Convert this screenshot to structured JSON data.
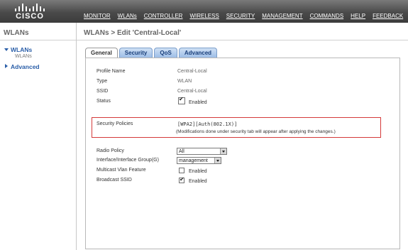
{
  "header": {
    "logo_text": "CISCO",
    "nav": [
      "MONITOR",
      "WLANs",
      "CONTROLLER",
      "WIRELESS",
      "SECURITY",
      "MANAGEMENT",
      "COMMANDS",
      "HELP",
      "FEEDBACK"
    ]
  },
  "sidebar": {
    "title": "WLANs",
    "items": [
      {
        "label": "WLANs",
        "sub": "WLANs",
        "expanded": true
      },
      {
        "label": "Advanced",
        "expanded": false
      }
    ]
  },
  "main": {
    "title": "WLANs > Edit  'Central-Local'",
    "tabs": [
      {
        "label": "General",
        "active": true
      },
      {
        "label": "Security",
        "active": false
      },
      {
        "label": "QoS",
        "active": false
      },
      {
        "label": "Advanced",
        "active": false
      }
    ],
    "fields": {
      "profile_name_label": "Profile Name",
      "profile_name_value": "Central-Local",
      "type_label": "Type",
      "type_value": "WLAN",
      "ssid_label": "SSID",
      "ssid_value": "Central-Local",
      "status_label": "Status",
      "status_checkbox_label": "Enabled",
      "status_checked": true,
      "security_label": "Security Policies",
      "security_value": "[WPA2][Auth(802.1X)]",
      "security_note": "(Modifications done under security tab will appear after applying the changes.)",
      "radio_policy_label": "Radio Policy",
      "radio_policy_value": "All",
      "interface_label": "Interface/Interface Group(G)",
      "interface_value": "management",
      "multicast_label": "Multicast Vlan Feature",
      "multicast_checkbox_label": "Enabled",
      "multicast_checked": false,
      "broadcast_label": "Broadcast SSID",
      "broadcast_checkbox_label": "Enabled",
      "broadcast_checked": true
    }
  },
  "colors": {
    "header_bg": "#4a4a4a",
    "link_blue": "#2a5ea8",
    "highlight_red": "#d43a3a",
    "tab_blue": "#9dbde6"
  }
}
